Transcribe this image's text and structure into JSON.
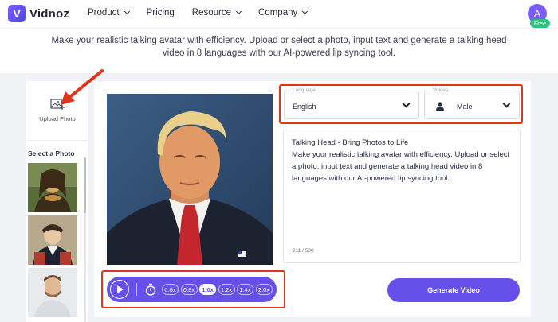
{
  "header": {
    "logo_text": "Vidnoz",
    "logo_letter": "V",
    "nav": [
      {
        "label": "Product",
        "has_dropdown": true
      },
      {
        "label": "Pricing",
        "has_dropdown": false
      },
      {
        "label": "Resource",
        "has_dropdown": true
      },
      {
        "label": "Company",
        "has_dropdown": true
      }
    ],
    "avatar_letter": "A",
    "plan_badge": "Free"
  },
  "description": "Make your realistic talking avatar with efficiency. Upload or select a photo, input text and generate a talking head video in 8 languages with our AI-powered lip syncing tool.",
  "left_panel": {
    "upload_label": "Upload Photo",
    "select_label": "Select a Photo",
    "thumbnails": [
      "mona-lisa-thumbnail",
      "napoleon-thumbnail",
      "man-portrait-thumbnail"
    ]
  },
  "editor": {
    "language": {
      "caption": "Language",
      "value": "English"
    },
    "voices": {
      "caption": "Voices",
      "value": "Male"
    },
    "text_title": "Talking Head - Bring Photos to Life",
    "text_body": "Make your realistic talking avatar with efficiency. Upload or select a photo, input text and generate a talking head video in 8 languages with our AI-powered lip syncing tool.",
    "char_count": "211 / 500",
    "speeds": [
      "0.6x",
      "0.8x",
      "1.0x",
      "1.2x",
      "1.4x",
      "2.0x"
    ],
    "active_speed": "1.0x",
    "generate_label": "Generate Video"
  },
  "colors": {
    "accent": "#6750ea",
    "highlight": "#e0341f",
    "free_badge": "#2ec27e"
  }
}
